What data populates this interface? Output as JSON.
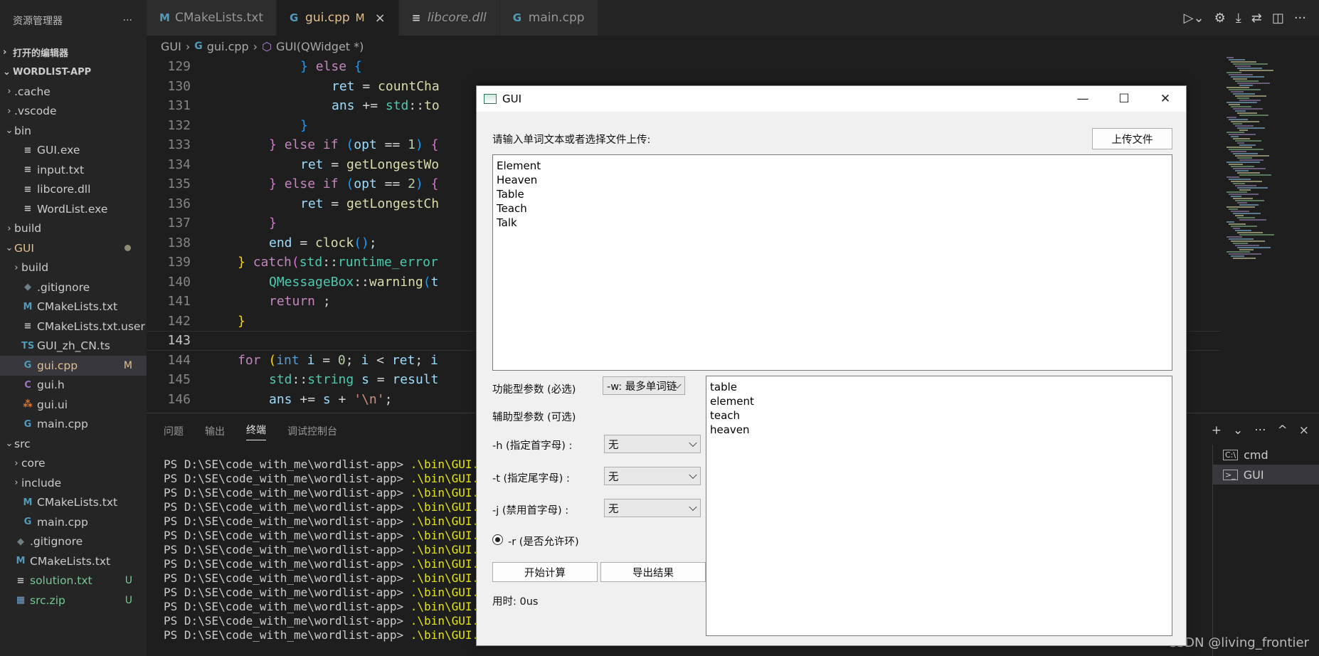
{
  "sidebar": {
    "header": "资源管理器",
    "header_more": "···",
    "open_editors": "打开的编辑器",
    "project": "WORDLIST-APP",
    "items": [
      {
        "label": ".cache",
        "indent": 1,
        "chev": "›",
        "icon": "",
        "color": "#cccccc"
      },
      {
        "label": ".vscode",
        "indent": 1,
        "chev": "›",
        "icon": "",
        "color": "#cccccc"
      },
      {
        "label": "bin",
        "indent": 1,
        "chev": "⌄",
        "icon": "",
        "color": "#cccccc"
      },
      {
        "label": "GUI.exe",
        "indent": 2,
        "chev": "",
        "icon": "≡",
        "color": "#cccccc"
      },
      {
        "label": "input.txt",
        "indent": 2,
        "chev": "",
        "icon": "≡",
        "color": "#cccccc"
      },
      {
        "label": "libcore.dll",
        "indent": 2,
        "chev": "",
        "icon": "≡",
        "color": "#cccccc"
      },
      {
        "label": "WordList.exe",
        "indent": 2,
        "chev": "",
        "icon": "≡",
        "color": "#cccccc"
      },
      {
        "label": "build",
        "indent": 1,
        "chev": "›",
        "icon": "",
        "color": "#cccccc"
      },
      {
        "label": "GUI",
        "indent": 1,
        "chev": "⌄",
        "icon": "",
        "color": "#e2c08d",
        "dot": true
      },
      {
        "label": "build",
        "indent": 2,
        "chev": "›",
        "icon": "",
        "color": "#cccccc"
      },
      {
        "label": ".gitignore",
        "indent": 2,
        "chev": "",
        "icon": "◆",
        "color": "#cccccc"
      },
      {
        "label": "CMakeLists.txt",
        "indent": 2,
        "chev": "",
        "icon": "M",
        "color": "#cccccc"
      },
      {
        "label": "CMakeLists.txt.user",
        "indent": 2,
        "chev": "",
        "icon": "≡",
        "color": "#cccccc"
      },
      {
        "label": "GUI_zh_CN.ts",
        "indent": 2,
        "chev": "",
        "icon": "TS",
        "color": "#cccccc"
      },
      {
        "label": "gui.cpp",
        "indent": 2,
        "chev": "",
        "icon": "G",
        "color": "#e2c08d",
        "badge": "M",
        "active": true
      },
      {
        "label": "gui.h",
        "indent": 2,
        "chev": "",
        "icon": "C",
        "color": "#cccccc"
      },
      {
        "label": "gui.ui",
        "indent": 2,
        "chev": "",
        "icon": "⁂",
        "color": "#cccccc"
      },
      {
        "label": "main.cpp",
        "indent": 2,
        "chev": "",
        "icon": "G",
        "color": "#cccccc"
      },
      {
        "label": "src",
        "indent": 1,
        "chev": "⌄",
        "icon": "",
        "color": "#cccccc"
      },
      {
        "label": "core",
        "indent": 2,
        "chev": "›",
        "icon": "",
        "color": "#cccccc"
      },
      {
        "label": "include",
        "indent": 2,
        "chev": "›",
        "icon": "",
        "color": "#cccccc"
      },
      {
        "label": "CMakeLists.txt",
        "indent": 2,
        "chev": "",
        "icon": "M",
        "color": "#cccccc"
      },
      {
        "label": "main.cpp",
        "indent": 2,
        "chev": "",
        "icon": "G",
        "color": "#cccccc"
      },
      {
        "label": ".gitignore",
        "indent": 1,
        "chev": "",
        "icon": "◆",
        "color": "#cccccc"
      },
      {
        "label": "CMakeLists.txt",
        "indent": 1,
        "chev": "",
        "icon": "M",
        "color": "#cccccc"
      },
      {
        "label": "solution.txt",
        "indent": 1,
        "chev": "",
        "icon": "≡",
        "color": "#73c991",
        "badge": "U"
      },
      {
        "label": "src.zip",
        "indent": 1,
        "chev": "",
        "icon": "▦",
        "color": "#73c991",
        "badge": "U"
      }
    ]
  },
  "tabs": [
    {
      "label": "CMakeLists.txt",
      "icon": "M",
      "icon_color": "#519aba",
      "active": false,
      "italic": false
    },
    {
      "label": "gui.cpp",
      "icon": "G",
      "icon_color": "#519aba",
      "active": true,
      "modified": "M",
      "close": "×",
      "label_color": "#e2c08d"
    },
    {
      "label": "libcore.dll",
      "icon": "≡",
      "icon_color": "#cccccc",
      "active": false,
      "italic": true
    },
    {
      "label": "main.cpp",
      "icon": "G",
      "icon_color": "#519aba",
      "active": false,
      "italic": false
    }
  ],
  "breadcrumb": [
    "GUI",
    "gui.cpp",
    "GUI(QWidget *)"
  ],
  "breadcrumb_sep": "›",
  "editor": {
    "lines": [
      {
        "n": "129",
        "indent": 12,
        "tokens": [
          [
            "br3",
            "}"
          ],
          [
            "",
            " "
          ],
          [
            "kw",
            "else"
          ],
          [
            "",
            " "
          ],
          [
            "br3",
            "{"
          ]
        ]
      },
      {
        "n": "130",
        "indent": 16,
        "tokens": [
          [
            "var",
            "ret"
          ],
          [
            "",
            " = "
          ],
          [
            "fn",
            "countCha"
          ]
        ]
      },
      {
        "n": "131",
        "indent": 16,
        "tokens": [
          [
            "var",
            "ans"
          ],
          [
            "",
            " += "
          ],
          [
            "ty",
            "std"
          ],
          [
            "",
            "::"
          ],
          [
            "fn",
            "to"
          ]
        ]
      },
      {
        "n": "132",
        "indent": 12,
        "tokens": [
          [
            "br3",
            "}"
          ]
        ]
      },
      {
        "n": "133",
        "indent": 8,
        "tokens": [
          [
            "br2",
            "}"
          ],
          [
            "",
            " "
          ],
          [
            "kw",
            "else"
          ],
          [
            "",
            " "
          ],
          [
            "kw",
            "if"
          ],
          [
            "",
            " "
          ],
          [
            "br3",
            "("
          ],
          [
            "var",
            "opt"
          ],
          [
            "",
            " == "
          ],
          [
            "num",
            "1"
          ],
          [
            "br3",
            ")"
          ],
          [
            "",
            " "
          ],
          [
            "br2",
            "{"
          ]
        ]
      },
      {
        "n": "134",
        "indent": 12,
        "tokens": [
          [
            "var",
            "ret"
          ],
          [
            "",
            " = "
          ],
          [
            "fn",
            "getLongestWo"
          ]
        ]
      },
      {
        "n": "135",
        "indent": 8,
        "tokens": [
          [
            "br2",
            "}"
          ],
          [
            "",
            " "
          ],
          [
            "kw",
            "else"
          ],
          [
            "",
            " "
          ],
          [
            "kw",
            "if"
          ],
          [
            "",
            " "
          ],
          [
            "br3",
            "("
          ],
          [
            "var",
            "opt"
          ],
          [
            "",
            " == "
          ],
          [
            "num",
            "2"
          ],
          [
            "br3",
            ")"
          ],
          [
            "",
            " "
          ],
          [
            "br2",
            "{"
          ]
        ]
      },
      {
        "n": "136",
        "indent": 12,
        "tokens": [
          [
            "var",
            "ret"
          ],
          [
            "",
            " = "
          ],
          [
            "fn",
            "getLongestCh"
          ]
        ]
      },
      {
        "n": "137",
        "indent": 8,
        "tokens": [
          [
            "br2",
            "}"
          ]
        ]
      },
      {
        "n": "138",
        "indent": 8,
        "tokens": [
          [
            "var",
            "end"
          ],
          [
            "",
            " = "
          ],
          [
            "fn",
            "clock"
          ],
          [
            "br3",
            "()"
          ],
          [
            "",
            ";"
          ]
        ]
      },
      {
        "n": "139",
        "indent": 4,
        "tokens": [
          [
            "br",
            "}"
          ],
          [
            "",
            " "
          ],
          [
            "kw",
            "catch"
          ],
          [
            "br2",
            "("
          ],
          [
            "ty",
            "std"
          ],
          [
            "",
            "::"
          ],
          [
            "ty",
            "runtime_error"
          ]
        ]
      },
      {
        "n": "140",
        "indent": 8,
        "tokens": [
          [
            "ty",
            "QMessageBox"
          ],
          [
            "",
            "::"
          ],
          [
            "fn",
            "warning"
          ],
          [
            "br3",
            "("
          ],
          [
            "var",
            "t"
          ]
        ]
      },
      {
        "n": "141",
        "indent": 8,
        "tokens": [
          [
            "kw",
            "return"
          ],
          [
            "",
            " ;"
          ]
        ]
      },
      {
        "n": "142",
        "indent": 4,
        "tokens": [
          [
            "br",
            "}"
          ]
        ]
      },
      {
        "n": "143",
        "indent": 0,
        "tokens": [],
        "current": true
      },
      {
        "n": "144",
        "indent": 4,
        "tokens": [
          [
            "kw",
            "for"
          ],
          [
            "",
            " "
          ],
          [
            "br",
            "("
          ],
          [
            "kw2",
            "int"
          ],
          [
            "",
            " "
          ],
          [
            "var",
            "i"
          ],
          [
            "",
            " = "
          ],
          [
            "num",
            "0"
          ],
          [
            "",
            "; "
          ],
          [
            "var",
            "i"
          ],
          [
            "",
            " < "
          ],
          [
            "var",
            "ret"
          ],
          [
            "",
            "; "
          ],
          [
            "var",
            "i"
          ]
        ]
      },
      {
        "n": "145",
        "indent": 8,
        "tokens": [
          [
            "ty",
            "std"
          ],
          [
            "",
            "::"
          ],
          [
            "ty",
            "string"
          ],
          [
            "",
            " "
          ],
          [
            "var",
            "s"
          ],
          [
            "",
            " = "
          ],
          [
            "var",
            "result"
          ]
        ]
      },
      {
        "n": "146",
        "indent": 8,
        "tokens": [
          [
            "var",
            "ans"
          ],
          [
            "",
            " += "
          ],
          [
            "var",
            "s"
          ],
          [
            "",
            " + "
          ],
          [
            "str",
            "'\\n'"
          ],
          [
            "",
            ";"
          ]
        ]
      }
    ]
  },
  "panel": {
    "tabs": [
      "问题",
      "输出",
      "终端",
      "调试控制台"
    ],
    "active_tab": "终端",
    "terminal_lines": [
      {
        "prompt": "PS D:\\SE\\code_with_me\\wordlist-app> ",
        "cmd": ".\\bin\\GUI.exe"
      },
      {
        "prompt": "PS D:\\SE\\code_with_me\\wordlist-app> ",
        "cmd": ".\\bin\\GUI.exe"
      },
      {
        "prompt": "PS D:\\SE\\code_with_me\\wordlist-app> ",
        "cmd": ".\\bin\\GUI.exe"
      },
      {
        "prompt": "PS D:\\SE\\code_with_me\\wordlist-app> ",
        "cmd": ".\\bin\\GUI.exe"
      },
      {
        "prompt": "PS D:\\SE\\code_with_me\\wordlist-app> ",
        "cmd": ".\\bin\\GUI.exe"
      },
      {
        "prompt": "PS D:\\SE\\code_with_me\\wordlist-app> ",
        "cmd": ".\\bin\\GUI.exe"
      },
      {
        "prompt": "PS D:\\SE\\code_with_me\\wordlist-app> ",
        "cmd": ".\\bin\\GUI.exe"
      },
      {
        "prompt": "PS D:\\SE\\code_with_me\\wordlist-app> ",
        "cmd": ".\\bin\\GUI.exe"
      },
      {
        "prompt": "PS D:\\SE\\code_with_me\\wordlist-app> ",
        "cmd": ".\\bin\\GUI.exe"
      },
      {
        "prompt": "PS D:\\SE\\code_with_me\\wordlist-app> ",
        "cmd": ".\\bin\\GUI.exe"
      },
      {
        "prompt": "PS D:\\SE\\code_with_me\\wordlist-app> ",
        "cmd": ".\\bin\\GUI.exe"
      },
      {
        "prompt": "PS D:\\SE\\code_with_me\\wordlist-app> ",
        "cmd": ".\\bin\\GUI.exe"
      },
      {
        "prompt": "PS D:\\SE\\code_with_me\\wordlist-app> ",
        "cmd": ".\\bin\\GUI.exe"
      }
    ],
    "terminals": [
      {
        "label": "cmd",
        "icon": "C:\\"
      },
      {
        "label": "GUI",
        "icon": ">_",
        "active": true
      }
    ],
    "actions": [
      "+",
      "⌄",
      "···",
      "^",
      "×"
    ]
  },
  "watermark": "CSDN @living_frontier",
  "gui": {
    "title": "GUI",
    "minimize": "—",
    "maximize": "☐",
    "close": "✕",
    "prompt_label": "请输入单词文本或者选择文件上传:",
    "upload_button": "上传文件",
    "input_words": [
      "Element",
      "Heaven",
      "Table",
      "Teach",
      "Talk"
    ],
    "func_param_label": "功能型参数 (必选)",
    "func_param_value": "-w: 最多单词链",
    "aux_param_label": "辅助型参数 (可选)",
    "h_label": "-h (指定首字母) :",
    "h_value": "无",
    "t_label": "-t (指定尾字母) :",
    "t_value": "无",
    "j_label": "-j (禁用首字母) :",
    "j_value": "无",
    "r_label": "-r (是否允许环)",
    "start_button": "开始计算",
    "export_button": "导出结果",
    "time_label": "用时: 0us",
    "output_words": [
      "table",
      "element",
      "teach",
      "heaven"
    ]
  }
}
